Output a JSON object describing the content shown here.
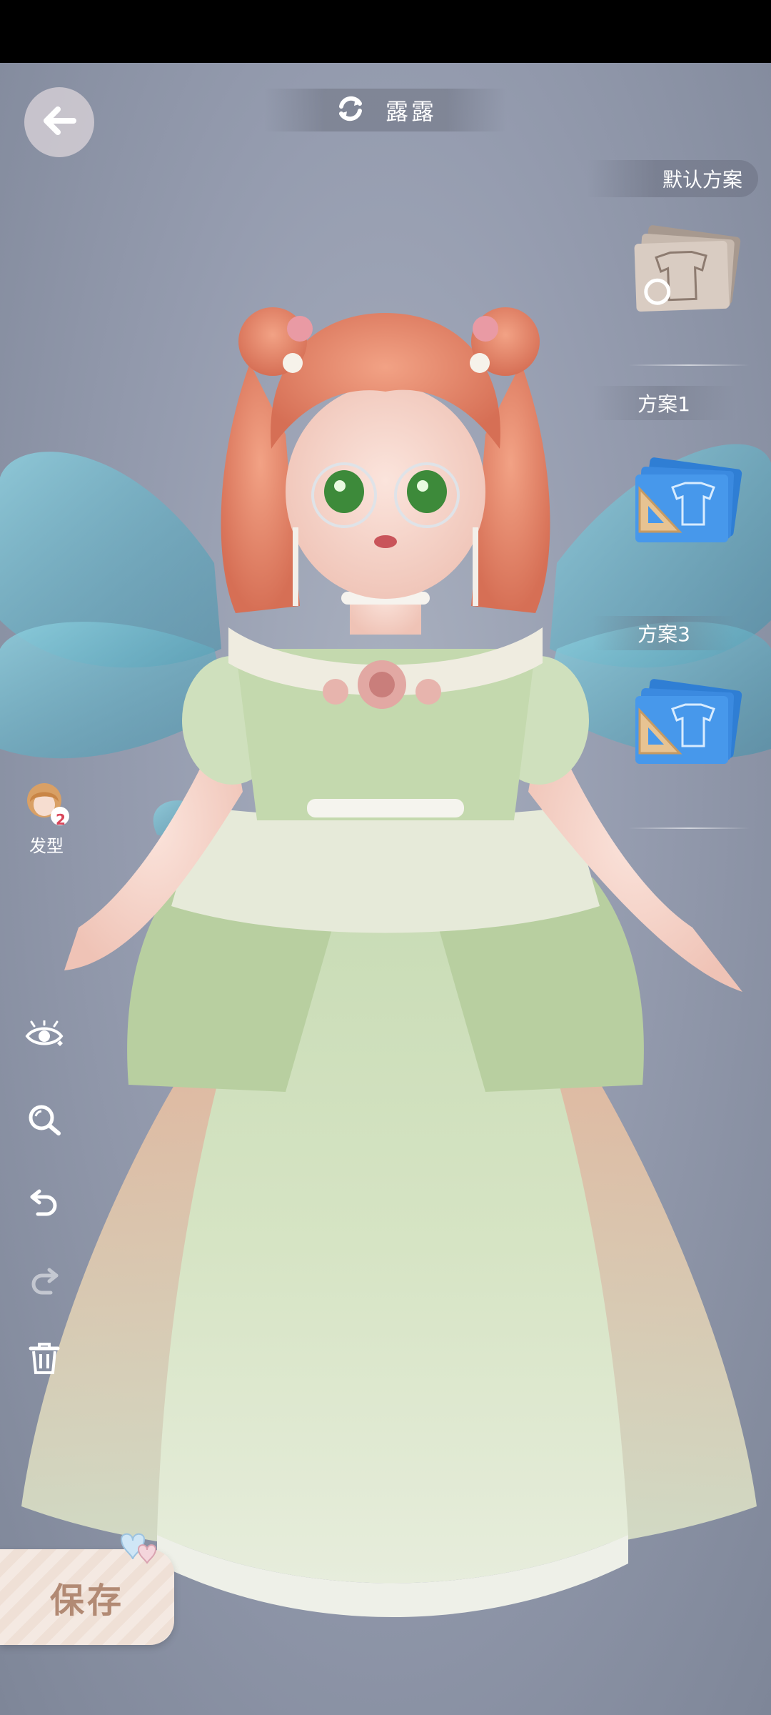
{
  "header": {
    "character_name": "露露",
    "back_icon": "arrow-left-icon",
    "switch_icon": "refresh-icon"
  },
  "schemes": {
    "default_label": "默认方案",
    "items": [
      {
        "label": "方案1"
      },
      {
        "label": "方案3"
      }
    ]
  },
  "tools": {
    "hair_label": "发型",
    "hair_badge": "2",
    "icons": [
      "eye-icon",
      "zoom-icon",
      "undo-icon",
      "redo-icon",
      "trash-icon"
    ]
  },
  "save": {
    "label": "保存"
  },
  "colors": {
    "background": "#959caf",
    "hair": "#e5876c",
    "dress_green": "#c8dcb4",
    "skirt_peach": "#f0c7a8",
    "wing": "#6fb3c9",
    "card_blue": "#3f8fe0"
  }
}
